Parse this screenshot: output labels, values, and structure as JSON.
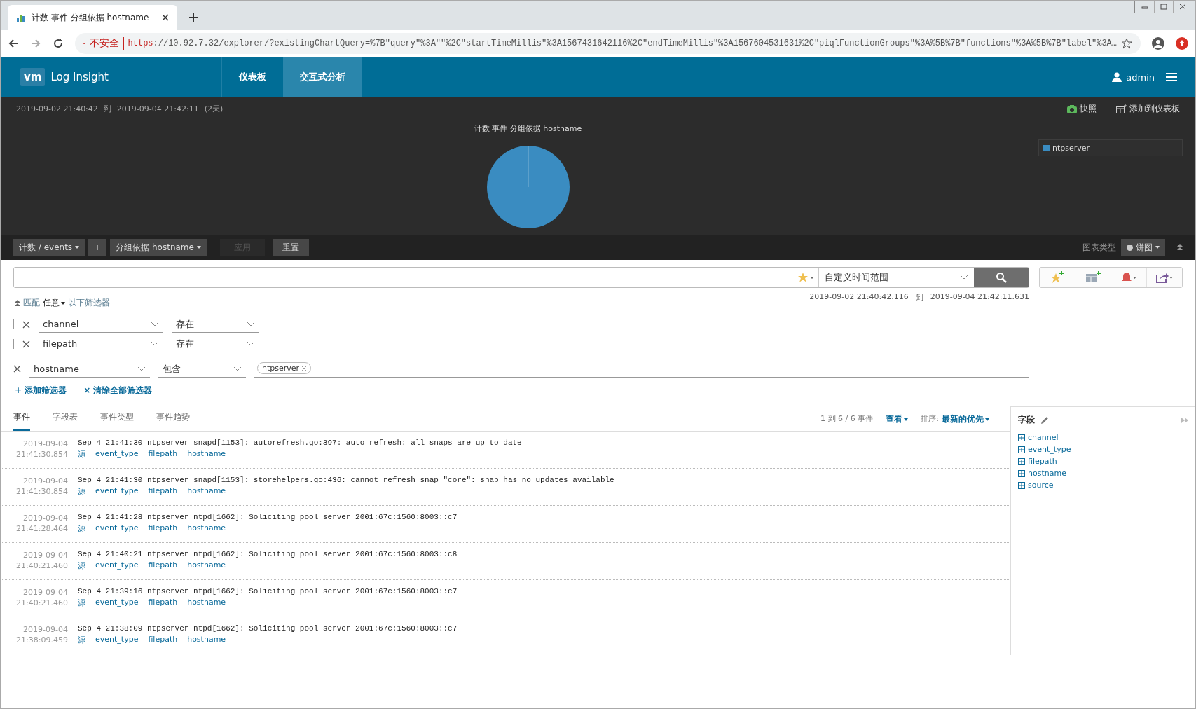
{
  "browser": {
    "tab_title": "计数 事件 分组依据 hostname -",
    "security": "不安全",
    "url_scheme": "https",
    "url_rest": "://10.92.7.32/explorer/?existingChartQuery=%7B\"query\"%3A\"\"%2C\"startTimeMillis\"%3A1567431642116%2C\"endTimeMillis\"%3A1567604531631%2C\"piqlFunctionGroups\"%3A%5B%7B\"functions\"%3A%5B%7B\"label\"%3A…"
  },
  "header": {
    "logo": "vm",
    "product": "Log Insight",
    "nav": [
      {
        "label": "仪表板",
        "selected": false
      },
      {
        "label": "交互式分析",
        "selected": true
      }
    ],
    "user": "admin"
  },
  "chart_panel": {
    "range_start": "2019-09-02  21:40:42",
    "range_sep": "到",
    "range_end": "2019-09-04  21:42:11",
    "duration": "(2天)",
    "actions": [
      "快照",
      "添加到仪表板"
    ],
    "title": "计数 事件 分组依据 hostname",
    "legend": [
      {
        "label": "ntpserver",
        "color": "#3a8cc1"
      }
    ]
  },
  "toolbar": {
    "function": "计数 / events",
    "add": "+",
    "group_by": "分组依据 hostname",
    "apply": {
      "label": "应用",
      "disabled": true
    },
    "reset": "重置",
    "chart_type_label": "图表类型",
    "chart_type": "饼图"
  },
  "search": {
    "time_range": "自定义时间范围",
    "range_from": "2019-09-02  21:40:42.116",
    "range_sep": "到",
    "range_to": "2019-09-04  21:42:11.631"
  },
  "filter_match": {
    "prefix": "匹配",
    "mode": "任意",
    "suffix": "以下筛选器"
  },
  "filters": [
    {
      "field": "channel",
      "operator": "存在",
      "grouped": true
    },
    {
      "field": "filepath",
      "operator": "存在",
      "grouped": true
    },
    {
      "field": "hostname",
      "operator": "包含",
      "grouped": false,
      "values": [
        "ntpserver"
      ]
    }
  ],
  "filter_actions": [
    "+ 添加筛选器",
    "× 清除全部筛选器"
  ],
  "tabs": [
    {
      "label": "事件",
      "selected": true
    },
    {
      "label": "字段表",
      "selected": false
    },
    {
      "label": "事件类型",
      "selected": false
    },
    {
      "label": "事件趋势",
      "selected": false
    }
  ],
  "results": {
    "count": "1 到 6 / 6 事件",
    "view": "查看",
    "sort_label": "排序:",
    "sort": "最新的优先"
  },
  "events": [
    {
      "date": "2019-09-04",
      "time": "21:41:30.854",
      "message": "Sep  4 21:41:30 ntpserver snapd[1153]: autorefresh.go:397: auto-refresh: all snaps are up-to-date",
      "fields": [
        "源",
        "event_type",
        "filepath",
        "hostname"
      ]
    },
    {
      "date": "2019-09-04",
      "time": "21:41:30.854",
      "message": "Sep  4 21:41:30 ntpserver snapd[1153]: storehelpers.go:436: cannot refresh snap \"core\": snap has no updates available",
      "fields": [
        "源",
        "event_type",
        "filepath",
        "hostname"
      ]
    },
    {
      "date": "2019-09-04",
      "time": "21:41:28.464",
      "message": "Sep  4 21:41:28 ntpserver ntpd[1662]: Soliciting pool server 2001:67c:1560:8003::c7",
      "fields": [
        "源",
        "event_type",
        "filepath",
        "hostname"
      ]
    },
    {
      "date": "2019-09-04",
      "time": "21:40:21.460",
      "message": "Sep  4 21:40:21 ntpserver ntpd[1662]: Soliciting pool server 2001:67c:1560:8003::c8",
      "fields": [
        "源",
        "event_type",
        "filepath",
        "hostname"
      ]
    },
    {
      "date": "2019-09-04",
      "time": "21:40:21.460",
      "message": "Sep  4 21:39:16 ntpserver ntpd[1662]: Soliciting pool server 2001:67c:1560:8003::c7",
      "fields": [
        "源",
        "event_type",
        "filepath",
        "hostname"
      ]
    },
    {
      "date": "2019-09-04",
      "time": "21:38:09.459",
      "message": "Sep  4 21:38:09 ntpserver ntpd[1662]: Soliciting pool server 2001:67c:1560:8003::c7",
      "fields": [
        "源",
        "event_type",
        "filepath",
        "hostname"
      ]
    }
  ],
  "fields_panel": {
    "title": "字段",
    "items": [
      "channel",
      "event_type",
      "filepath",
      "hostname",
      "source"
    ]
  }
}
